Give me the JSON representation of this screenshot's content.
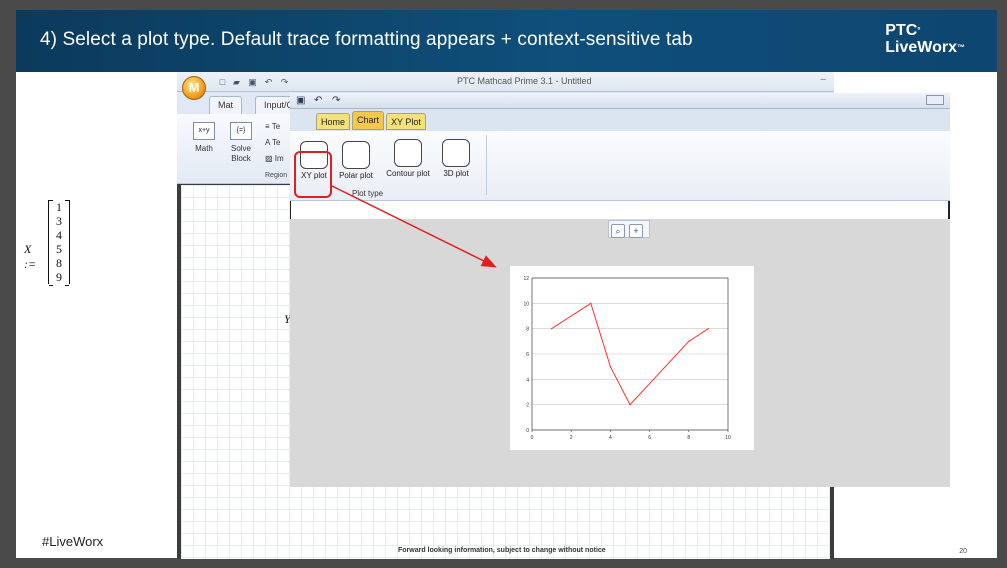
{
  "slide": {
    "title": "4) Select a plot type. Default trace formatting appears + context-sensitive tab",
    "brand_line1": "PTC",
    "brand_line2": "LiveWorx",
    "hashtag": "#LiveWorx",
    "footer_note": "Forward looking information, subject to change without notice",
    "page_number": "20",
    "colors": {
      "header": "#0f4f7a",
      "highlight": "#e02020"
    }
  },
  "mathcad": {
    "logo_letter": "M",
    "app_title": "PTC Mathcad Prime 3.1 - Untitled",
    "tabs": [
      "Mat",
      "Input/O"
    ],
    "ribbon": {
      "math_label": "Math",
      "solve_label_1": "Solve",
      "solve_label_2": "Block",
      "text_item_1": "Te",
      "text_item_2": "Te",
      "text_item_3": "Im",
      "regions_label": "Region"
    },
    "worksheet": {
      "x_label": "X :=",
      "x_values": [
        "1",
        "3",
        "4",
        "5",
        "8",
        "9"
      ],
      "y_label": "Y"
    }
  },
  "overlay": {
    "tabs": [
      {
        "label": "Home",
        "color": "#f5e17a"
      },
      {
        "label": "Chart",
        "color": "#f2c94c"
      },
      {
        "label": "XY Plot",
        "color": "#f5e17a"
      }
    ],
    "plot_types": [
      "XY plot",
      "Polar plot",
      "Contour plot",
      "3D plot"
    ],
    "plot_group_label": "Plot type",
    "zoom_icons": [
      "zoom-out-icon",
      "zoom-in-icon"
    ]
  },
  "chart_data": {
    "type": "line",
    "x": [
      1,
      3,
      4,
      5,
      8,
      9
    ],
    "series": [
      {
        "values": [
          8,
          10,
          5,
          2,
          7,
          8
        ],
        "color": "#ff2020"
      }
    ],
    "xlim": [
      0,
      10
    ],
    "ylim": [
      0,
      12
    ],
    "xticks": [
      "0",
      "2",
      "4",
      "6",
      "8",
      "10"
    ],
    "yticks": [
      "0",
      "2",
      "4",
      "6",
      "8",
      "10",
      "12"
    ],
    "grid": true
  }
}
